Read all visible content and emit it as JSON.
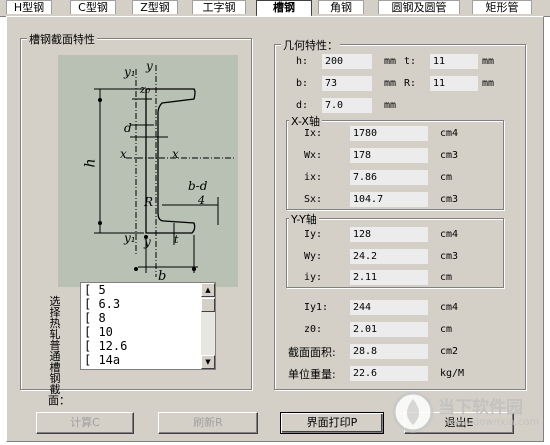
{
  "tabs": [
    {
      "label": "H型钢"
    },
    {
      "label": "C型钢"
    },
    {
      "label": "Z型钢"
    },
    {
      "label": "工字钢"
    },
    {
      "label": "槽钢"
    },
    {
      "label": "角钢"
    },
    {
      "label": "圆钢及圆管"
    },
    {
      "label": "矩形管"
    }
  ],
  "section_group": {
    "title": "槽钢截面特性"
  },
  "diagram_labels": {
    "y1_top": "y₁",
    "y_top": "y",
    "z0": "z₀",
    "d": "d",
    "h": "h",
    "x_left": "x",
    "x_right": "x",
    "b_d": "b-d",
    "four": "4",
    "R": "R",
    "t": "t",
    "y1_bottom": "y₁",
    "y_bottom": "y",
    "b": "b"
  },
  "list": {
    "side_label": "选择热轧普通槽钢截面：",
    "items": [
      "[ 5",
      "[ 6.3",
      "[ 8",
      "[ 10",
      "[ 12.6",
      "[ 14a"
    ]
  },
  "geometry": {
    "title": "几何特性：",
    "h": {
      "label": "h:",
      "value": "200",
      "unit": "mm"
    },
    "t": {
      "label": "t:",
      "value": "11",
      "unit": "mm"
    },
    "b": {
      "label": "b:",
      "value": "73",
      "unit": "mm"
    },
    "R": {
      "label": "R:",
      "value": "11",
      "unit": "mm"
    },
    "d": {
      "label": "d:",
      "value": "7.0",
      "unit": "mm"
    }
  },
  "xx_axis": {
    "title": "X-X轴",
    "Ix": {
      "label": "Ix:",
      "value": "1780",
      "unit": "cm4"
    },
    "Wx": {
      "label": "Wx:",
      "value": "178",
      "unit": "cm3"
    },
    "ix": {
      "label": "ix:",
      "value": "7.86",
      "unit": "cm"
    },
    "Sx": {
      "label": "Sx:",
      "value": "104.7",
      "unit": "cm3"
    }
  },
  "yy_axis": {
    "title": "Y-Y轴",
    "Iy": {
      "label": "Iy:",
      "value": "128",
      "unit": "cm4"
    },
    "Wy": {
      "label": "Wy:",
      "value": "24.2",
      "unit": "cm3"
    },
    "iy": {
      "label": "iy:",
      "value": "2.11",
      "unit": "cm"
    }
  },
  "other": {
    "Iy1": {
      "label": "Iy1:",
      "value": "244",
      "unit": "cm4"
    },
    "z0": {
      "label": "z0:",
      "value": "2.01",
      "unit": "cm"
    },
    "area": {
      "label": "截面面积:",
      "value": "28.8",
      "unit": "cm2"
    },
    "weight": {
      "label": "单位重量:",
      "value": "22.6",
      "unit": "kg/M"
    }
  },
  "buttons": {
    "calc": "计算C",
    "refresh": "刷新R",
    "print": "界面打印P",
    "exit": "退出E"
  },
  "watermark": {
    "text": "当下软件园",
    "url": "www.downxia.com"
  }
}
